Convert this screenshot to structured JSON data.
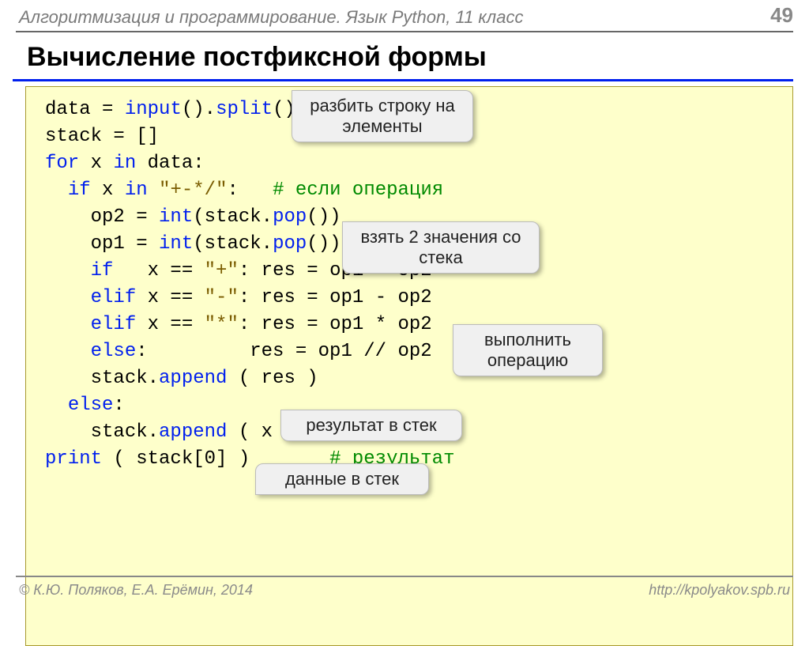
{
  "header": {
    "course": "Алгоритмизация и программирование. Язык Python, 11 класс",
    "page": "49"
  },
  "title": "Вычисление постфиксной формы",
  "code": {
    "l01a": "data = ",
    "l01b": "input",
    "l01c": "().",
    "l01d": "split",
    "l01e": "()",
    "l02": "stack = []",
    "l03a": "for",
    "l03b": " x ",
    "l03c": "in",
    "l03d": " data:",
    "l04a": "  ",
    "l04b": "if",
    "l04c": " x ",
    "l04d": "in",
    "l04e": " ",
    "l04f": "\"+-*/\"",
    "l04g": ":   ",
    "l04h": "# если операция",
    "l05a": "    op2 = ",
    "l05b": "int",
    "l05c": "(stack.",
    "l05d": "pop",
    "l05e": "())",
    "l06a": "    op1 = ",
    "l06b": "int",
    "l06c": "(stack.",
    "l06d": "pop",
    "l06e": "())",
    "l07a": "    ",
    "l07b": "if",
    "l07c": "   x == ",
    "l07d": "\"+\"",
    "l07e": ": res = op1 + op2",
    "l08a": "    ",
    "l08b": "elif",
    "l08c": " x == ",
    "l08d": "\"-\"",
    "l08e": ": res = op1 - op2",
    "l09a": "    ",
    "l09b": "elif",
    "l09c": " x == ",
    "l09d": "\"*\"",
    "l09e": ": res = op1 * op2",
    "l10a": "    ",
    "l10b": "else",
    "l10c": ":         res = op1 // op2",
    "l11a": "    stack.",
    "l11b": "append",
    "l11c": " ( res )",
    "l12a": "  ",
    "l12b": "else",
    "l12c": ":",
    "l13a": "    stack.",
    "l13b": "append",
    "l13c": " ( x )",
    "l14a": "print",
    "l14b": " ( stack[0] )       ",
    "l14c": "# результат"
  },
  "callouts": {
    "c1": "разбить строку\nна элементы",
    "c2": "взять 2 значения\nсо стека",
    "c3": "выполнить\nоперацию",
    "c4": "результат в стек",
    "c5": "данные в стек"
  },
  "footer": {
    "left": "© К.Ю. Поляков, Е.А. Ерёмин, 2014",
    "right": "http://kpolyakov.spb.ru"
  }
}
